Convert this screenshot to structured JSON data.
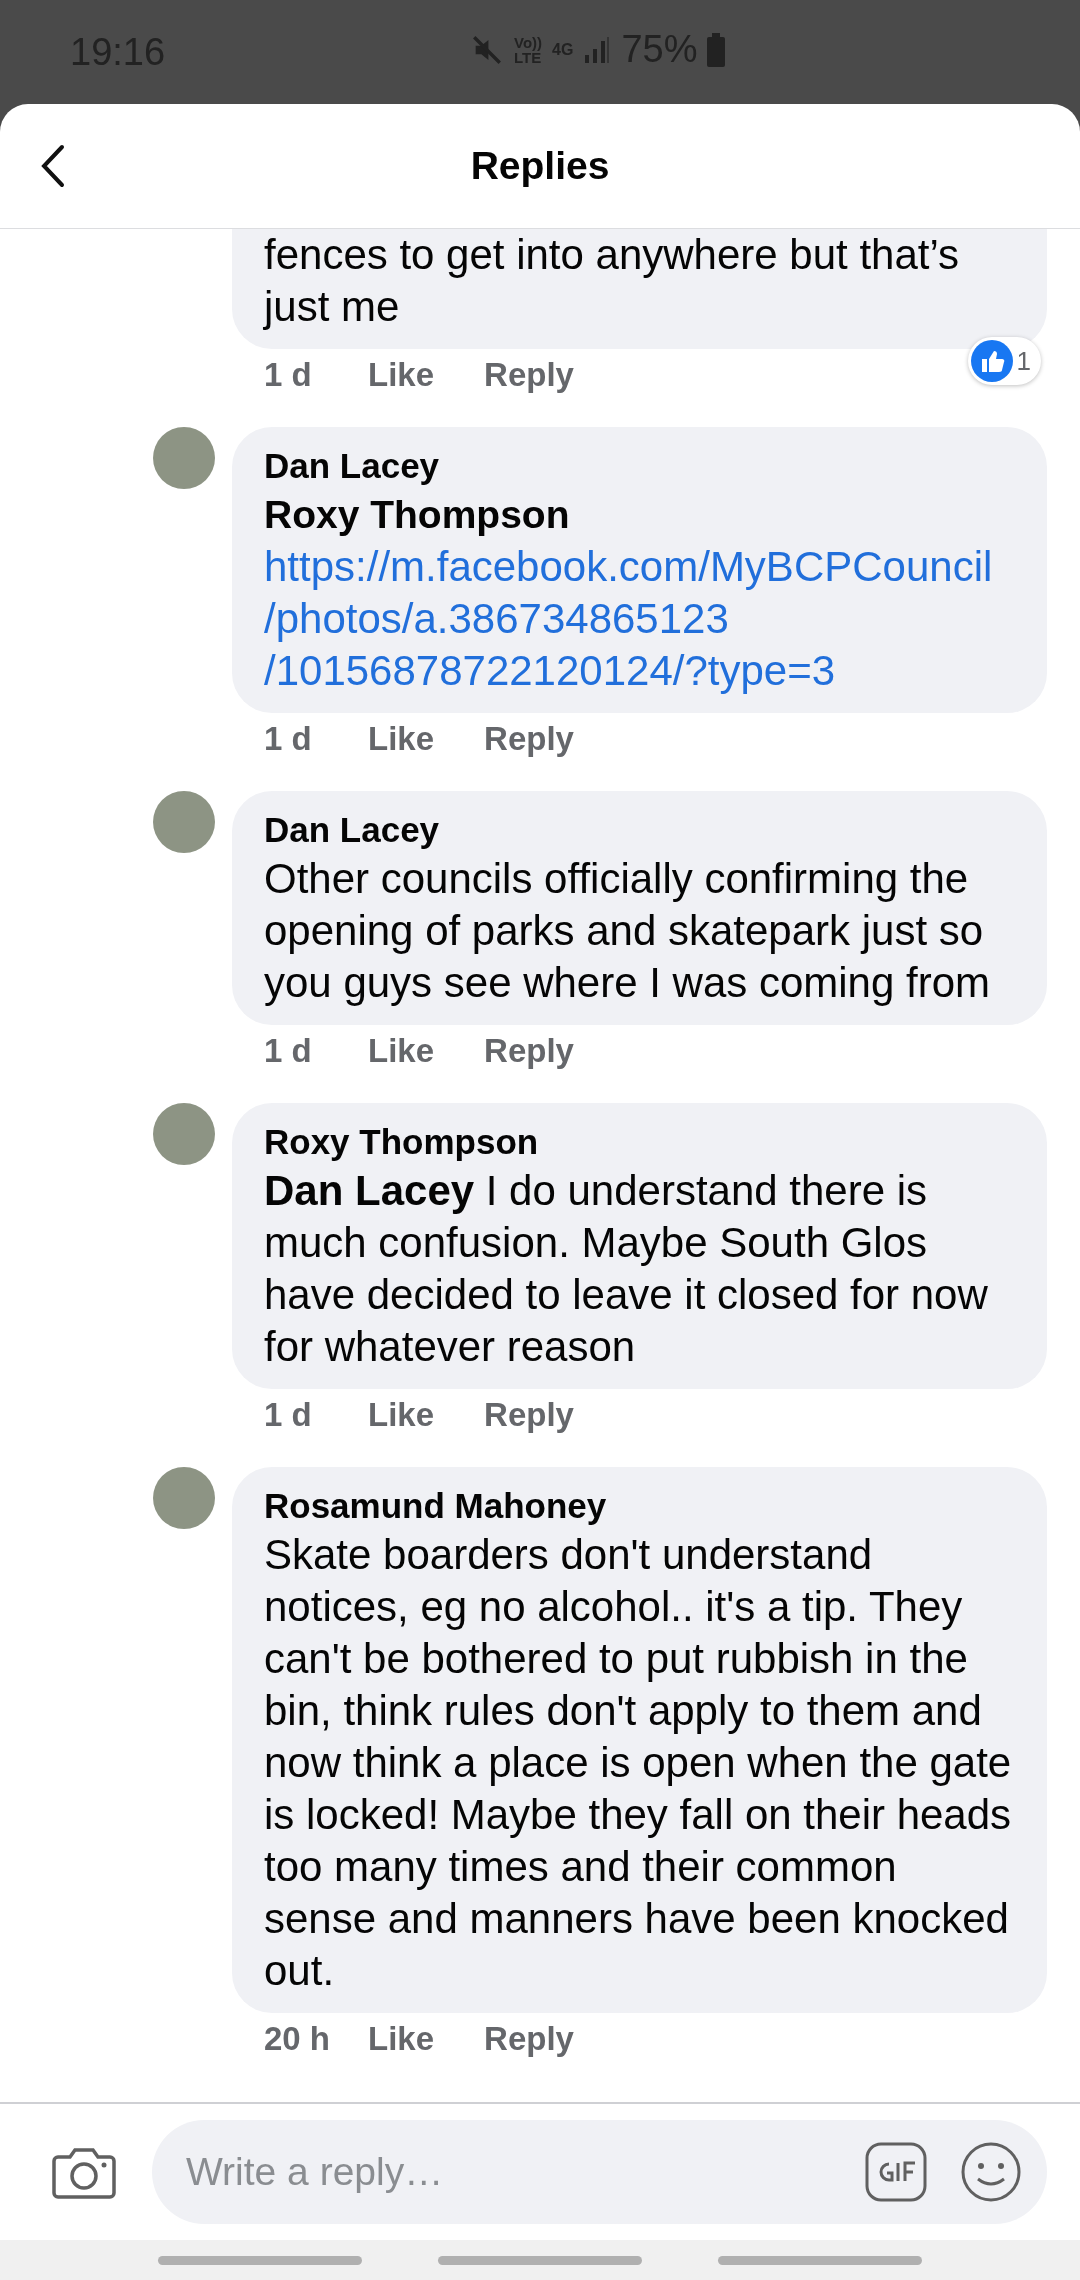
{
  "status_bar": {
    "time": "19:16",
    "volte": [
      "Vo))",
      "LTE"
    ],
    "network": "4G",
    "battery": "75%"
  },
  "header": {
    "title": "Replies"
  },
  "comments": [
    {
      "kind": "partial",
      "body": "fences to get into anywhere but that’s just me",
      "time": "1 d",
      "like": "Like",
      "reply": "Reply",
      "reaction_count": "1"
    },
    {
      "kind": "link",
      "author": "Dan Lacey",
      "mention": "Roxy Thompson",
      "link": "https://m.facebook.com/MyBCPCouncil/photos/a.386734865123/10156878722120124/?type=3",
      "time": "1 d",
      "like": "Like",
      "reply": "Reply"
    },
    {
      "kind": "text",
      "author": "Dan Lacey",
      "body": "Other councils officially confirming the opening of parks and skatepark just so you guys see where I was coming from",
      "time": "1 d",
      "like": "Like",
      "reply": "Reply"
    },
    {
      "kind": "text",
      "author": "Roxy Thompson",
      "body": "**Dan Lacey**  I do understand there is much confusion.  Maybe South Glos have decided to leave it closed for now for whatever reason",
      "time": "1 d",
      "like": "Like",
      "reply": "Reply"
    },
    {
      "kind": "text",
      "author": "Rosamund Mahoney",
      "body": "Skate boarders don't understand notices, eg no alcohol.. it's a tip. They can't be bothered to put rubbish in the bin, think rules don't apply to them and now think a place is open when the gate is locked! Maybe they fall on their heads too many times and their common sense and manners have been knocked out.",
      "time": "20 h",
      "like": "Like",
      "reply": "Reply"
    }
  ],
  "composer": {
    "placeholder": "Write a reply…"
  }
}
